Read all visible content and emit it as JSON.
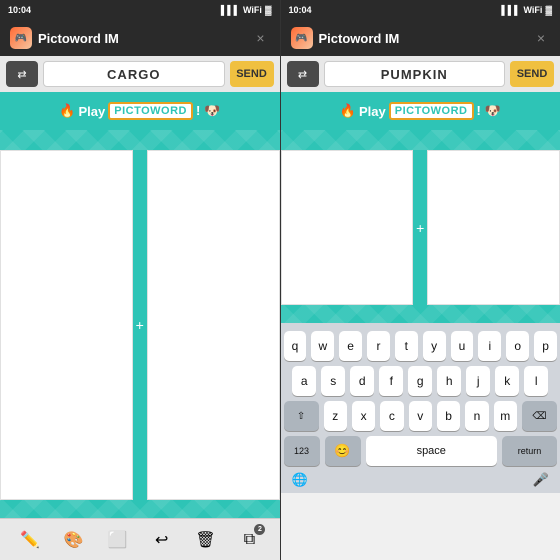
{
  "panels": [
    {
      "id": "left",
      "status": {
        "time": "10:04",
        "signal": "▌▌▌",
        "wifi": "WiFi",
        "battery": "🔋"
      },
      "titleBar": {
        "appName": "Pictoword IM",
        "closeBtn": "×"
      },
      "inputRow": {
        "shuffleLabel": "⇌",
        "wordValue": "CARGO",
        "sendLabel": "SEND"
      },
      "banner": {
        "fireEmoji": "🔥",
        "playLabel": "Play",
        "pictowordLabel": "PICTOWORD",
        "dogEmoji": "🐶"
      },
      "imageDividerSymbol": "+",
      "toolbar": {
        "tools": [
          {
            "icon": "✏️",
            "name": "pencil"
          },
          {
            "icon": "🎨",
            "name": "palette"
          },
          {
            "icon": "🧹",
            "name": "eraser"
          },
          {
            "icon": "↩️",
            "name": "undo"
          },
          {
            "icon": "🗑️",
            "name": "trash"
          },
          {
            "icon": "📋",
            "name": "layers",
            "badge": "2"
          }
        ]
      },
      "hasKeyboard": false
    },
    {
      "id": "right",
      "status": {
        "time": "10:04",
        "signal": "▌▌▌",
        "wifi": "WiFi",
        "battery": "🔋"
      },
      "titleBar": {
        "appName": "Pictoword IM",
        "closeBtn": "×"
      },
      "inputRow": {
        "shuffleLabel": "⇌",
        "wordValue": "PUMPKIN",
        "sendLabel": "SEND"
      },
      "banner": {
        "fireEmoji": "🔥",
        "playLabel": "Play",
        "pictowordLabel": "PICTOWORD",
        "dogEmoji": "🐶"
      },
      "imageDividerSymbol": "+",
      "keyboard": {
        "rows": [
          [
            "q",
            "w",
            "e",
            "r",
            "t",
            "y",
            "u",
            "i",
            "o",
            "p"
          ],
          [
            "a",
            "s",
            "d",
            "f",
            "g",
            "h",
            "j",
            "k",
            "l"
          ],
          [
            "⇧",
            "z",
            "x",
            "c",
            "v",
            "b",
            "n",
            "m",
            "⌫"
          ],
          [
            "123",
            "😊",
            "space",
            "return"
          ]
        ]
      },
      "hasKeyboard": true
    }
  ]
}
